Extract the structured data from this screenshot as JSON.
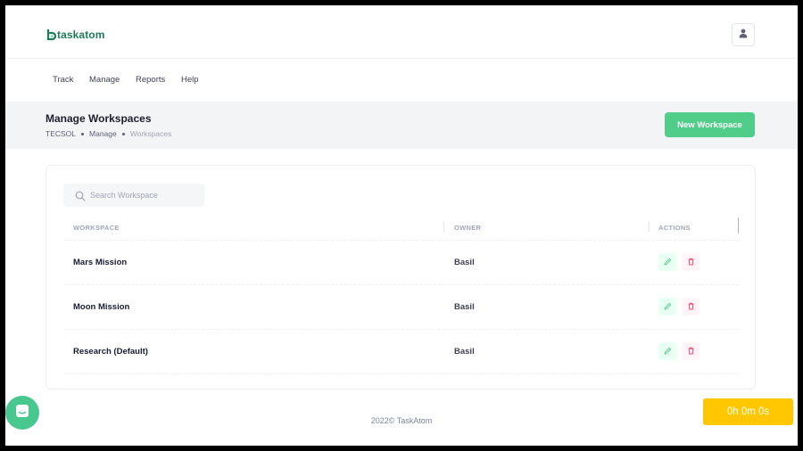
{
  "app": {
    "logo_text": "taskatom",
    "brand_color": "#50cd89"
  },
  "header": {
    "user_icon": "user-icon"
  },
  "nav": {
    "items": [
      {
        "label": "Track"
      },
      {
        "label": "Manage"
      },
      {
        "label": "Reports"
      },
      {
        "label": "Help"
      }
    ]
  },
  "page": {
    "title": "Manage Workspaces",
    "breadcrumb": [
      "TECSOL",
      "Manage",
      "Workspaces"
    ],
    "new_button": "New Workspace"
  },
  "search": {
    "placeholder": "Search Workspace",
    "value": ""
  },
  "table": {
    "columns": [
      "WORKSPACE",
      "OWNER",
      "ACTIONS"
    ],
    "rows": [
      {
        "workspace": "Mars Mission",
        "owner": "Basil"
      },
      {
        "workspace": "Moon Mission",
        "owner": "Basil"
      },
      {
        "workspace": "Research (Default)",
        "owner": "Basil"
      }
    ],
    "action_icons": [
      "pencil-icon",
      "trash-icon"
    ]
  },
  "footer": {
    "text": "2022© TaskAtom"
  },
  "timer": {
    "value": "0h 0m 0s",
    "color": "#ffc700"
  },
  "chat": {
    "icon": "chat-icon"
  }
}
